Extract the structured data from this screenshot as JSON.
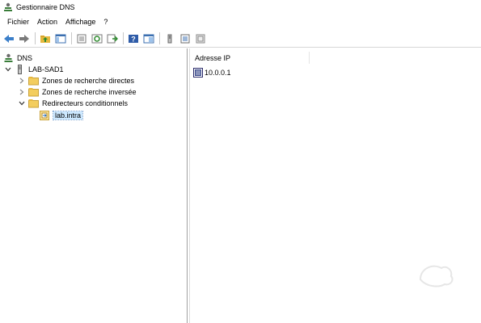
{
  "window": {
    "title": "Gestionnaire DNS",
    "icon": "dns-manager-icon"
  },
  "menu": [
    "Fichier",
    "Action",
    "Affichage",
    "?"
  ],
  "toolbar": {
    "buttons": [
      "back-arrow-icon",
      "forward-arrow-icon",
      "up-folder-icon",
      "show-hide-tree-icon",
      "properties-icon",
      "refresh-icon",
      "export-list-icon",
      "help-icon",
      "console-icon",
      "server-icon",
      "list-view-icon",
      "filter-icon"
    ]
  },
  "tree": {
    "root": "DNS",
    "server": "LAB-SAD1",
    "items": [
      {
        "label": "Zones de recherche directes",
        "expanded": false
      },
      {
        "label": "Zones de recherche inversée",
        "expanded": false
      },
      {
        "label": "Redirecteurs conditionnels",
        "expanded": true
      }
    ],
    "selected": "lab.intra"
  },
  "list": {
    "column": "Adresse IP",
    "rows": [
      "10.0.0.1"
    ]
  }
}
